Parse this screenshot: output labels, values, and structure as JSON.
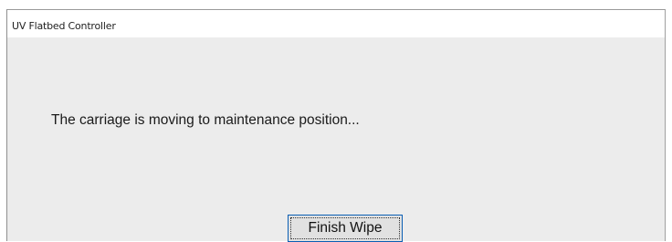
{
  "window": {
    "title": "UV Flatbed Controller"
  },
  "dialog": {
    "message": "The carriage is moving to maintenance position...",
    "finish_button_label": "Finish Wipe"
  }
}
